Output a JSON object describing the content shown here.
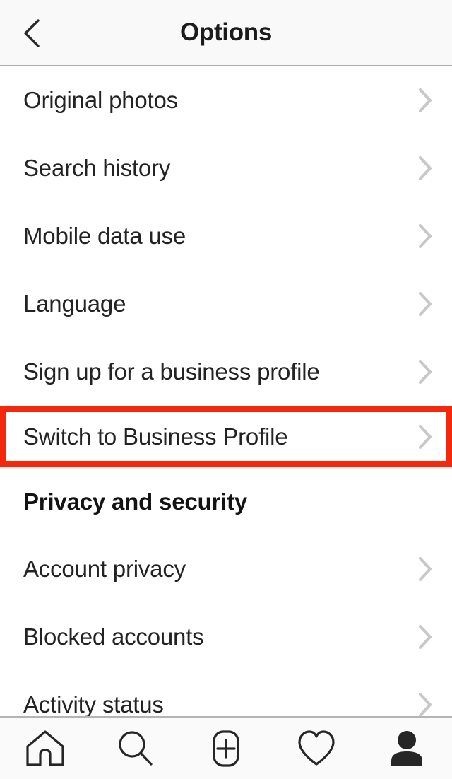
{
  "header": {
    "title": "Options",
    "back_icon": "chevron-left-icon"
  },
  "colors": {
    "highlight_border": "#f4280c",
    "text": "#232323",
    "chevron": "#c8c8c8",
    "header_bg": "#f9f9f9",
    "tabbar_bg": "#fafafa",
    "icon": "#262626"
  },
  "list": {
    "items": [
      {
        "label": "Original photos",
        "type": "link",
        "chevron": "chevron-right-icon",
        "highlighted": false
      },
      {
        "label": "Search history",
        "type": "link",
        "chevron": "chevron-right-icon",
        "highlighted": false
      },
      {
        "label": "Mobile data use",
        "type": "link",
        "chevron": "chevron-right-icon",
        "highlighted": false
      },
      {
        "label": "Language",
        "type": "link",
        "chevron": "chevron-right-icon",
        "highlighted": false
      },
      {
        "label": "Sign up for a business profile",
        "type": "link",
        "chevron": "chevron-right-icon",
        "highlighted": false
      },
      {
        "label": "Switch to Business Profile",
        "type": "link",
        "chevron": "chevron-right-icon",
        "highlighted": true
      },
      {
        "label": "Privacy and security",
        "type": "section-header",
        "chevron": "",
        "highlighted": false
      },
      {
        "label": "Account privacy",
        "type": "link",
        "chevron": "chevron-right-icon",
        "highlighted": false
      },
      {
        "label": "Blocked accounts",
        "type": "link",
        "chevron": "chevron-right-icon",
        "highlighted": false
      },
      {
        "label": "Activity status",
        "type": "link",
        "chevron": "chevron-right-icon",
        "highlighted": false
      }
    ]
  },
  "tabbar": {
    "items": [
      {
        "name": "home",
        "icon": "home-icon",
        "active": false
      },
      {
        "name": "search",
        "icon": "search-icon",
        "active": false
      },
      {
        "name": "add-post",
        "icon": "plus-square-icon",
        "active": false
      },
      {
        "name": "activity",
        "icon": "heart-icon",
        "active": false
      },
      {
        "name": "profile",
        "icon": "person-filled-icon",
        "active": true
      }
    ]
  }
}
